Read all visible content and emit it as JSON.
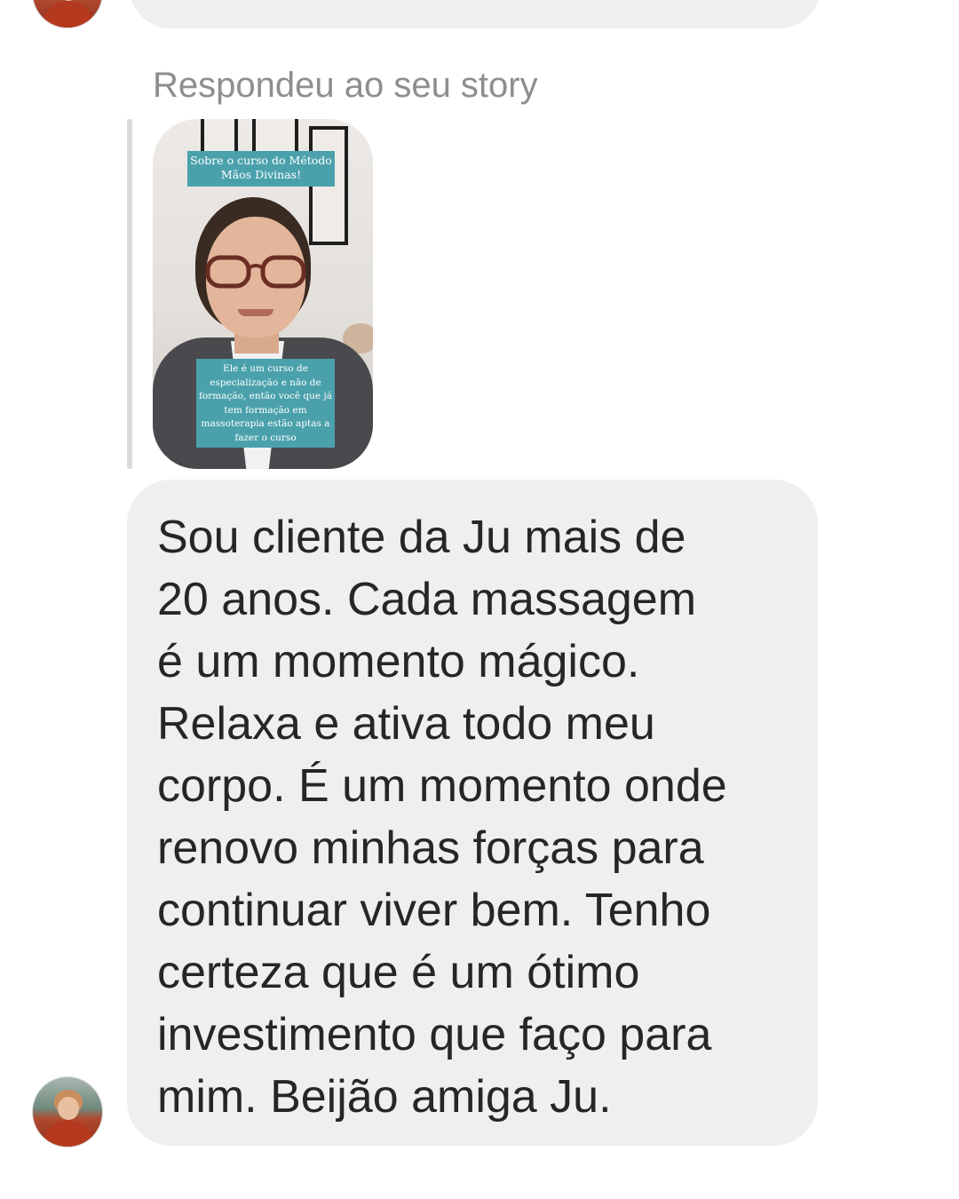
{
  "thread": {
    "reply_label": "Respondeu ao seu story",
    "story": {
      "caption_top": "Sobre o curso do Método Mãos Divinas!",
      "caption_bottom": "Ele é um curso de especialização e não de formação, então você que já tem formação em massoterapia estão aptas a fazer o curso"
    },
    "message": {
      "text": "Sou cliente da Ju mais de\n20 anos. Cada massagem\né um momento mágico.\nRelaxa e ativa todo meu\ncorpo. É um momento onde\nrenovo minhas forças para\ncontinuar viver bem. Tenho\ncerteza que é um ótimo\ninvestimento que faço para\nmim. Beijão amiga Ju."
    }
  },
  "colors": {
    "bubble_bg": "#efefef",
    "label_gray": "#8e8e8e",
    "text_dark": "#262626",
    "caption_teal": "#4aa1ac",
    "quote_line": "#dbdbdb"
  },
  "icons": {
    "sender_avatar": "profile-photo"
  }
}
